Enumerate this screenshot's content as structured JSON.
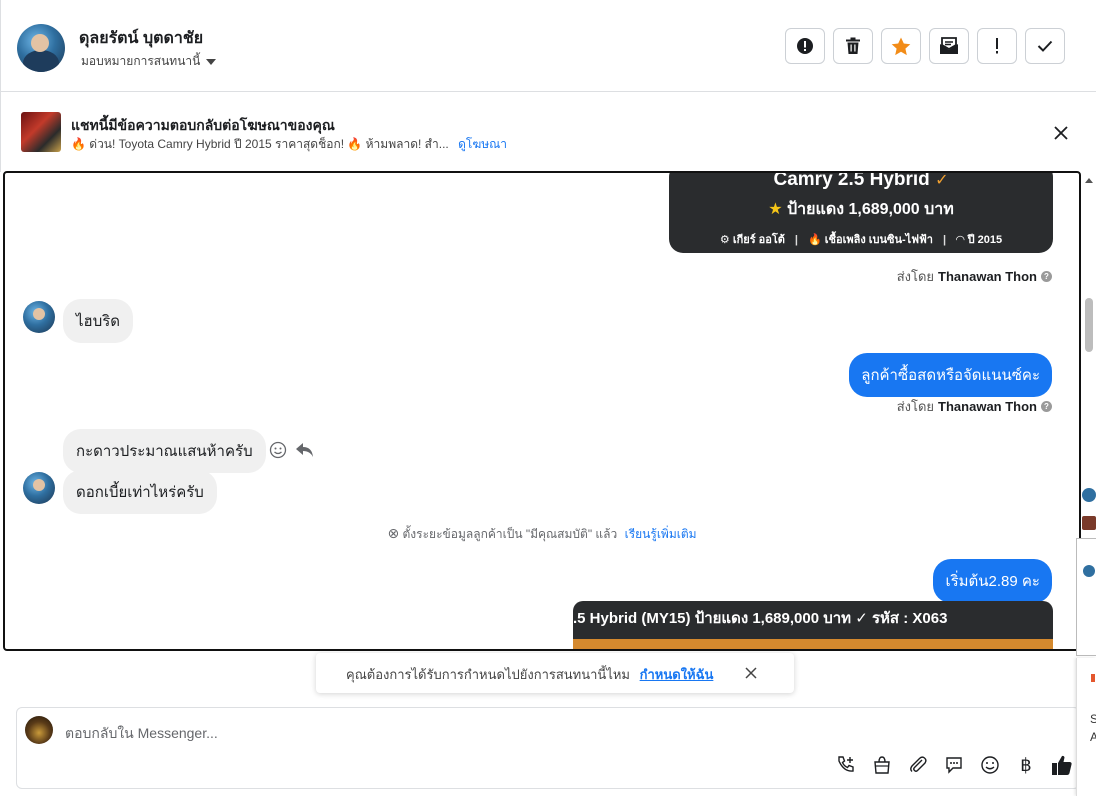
{
  "header": {
    "contact_name": "ดุลยรัตน์ บุตดาชัย",
    "assign_label": "มอบหมายการสนทนานี้",
    "actions": [
      {
        "name": "spam-button",
        "icon": "alert-circle-icon"
      },
      {
        "name": "delete-button",
        "icon": "trash-icon"
      },
      {
        "name": "star-button",
        "icon": "star-icon"
      },
      {
        "name": "mark-unread-button",
        "icon": "envelope-icon"
      },
      {
        "name": "follow-up-button",
        "icon": "exclamation-icon"
      },
      {
        "name": "mark-done-button",
        "icon": "check-icon"
      }
    ]
  },
  "ad_bar": {
    "title": "แชทนี้มีข้อความตอบกลับต่อโฆษณาของคุณ",
    "snippet": "🔥 ด่วน! Toyota Camry Hybrid ปี 2015 ราคาสุดช็อก! 🔥 ห้ามพลาด! สำ...",
    "link": "ดูโฆษณา"
  },
  "messages": {
    "card1": {
      "title": "Camry 2.5 Hybrid",
      "price": "ป้ายแดง 1,689,000 บาท",
      "meta": [
        "⚙ เกียร์ ออโต้",
        "🔥 เชื้อเพลิง เบนซิน-ไฟฟ้า",
        "◠ ปี 2015"
      ]
    },
    "sent_by_label": "ส่งโดย",
    "sent_by_name": "Thanawan Thon",
    "in_1": "ไฮบริด",
    "out_1": "ลูกค้าซื้อสดหรือจัดแนนซ์คะ",
    "in_2": "กะดาวประมาณแสนห้าครับ",
    "in_3": "ดอกเบี้ยเท่าไหร่ครับ",
    "system_text": "ตั้งระยะข้อมูลลูกค้าเป็น \"มีคุณสมบัติ\" แล้ว",
    "system_link": "เรียนรู้เพิ่มเติม",
    "out_2": "เริ่มต้น2.89 คะ",
    "card2_text": ".5 Hybrid (MY15) ป้ายแดง 1,689,000 บาท ✓ รหัส : X063"
  },
  "toast": {
    "text": "คุณต้องการได้รับการกำหนดไปยังการสนทนานี้ไหม",
    "link": "กำหนดให้ฉัน"
  },
  "composer": {
    "placeholder": "ตอบกลับใน Messenger...",
    "tools": [
      "call-add-icon",
      "shop-bag-icon",
      "paperclip-icon",
      "speech-bubble-icon",
      "emoji-icon",
      "baht-icon",
      "thumbs-up-icon"
    ]
  },
  "right_peek": {
    "text_1": "S",
    "text_2": "A"
  },
  "colors": {
    "accent": "#1877f2",
    "star": "#f28c18",
    "card_dark": "#2a2c2e",
    "card_orange": "#d4892e"
  }
}
